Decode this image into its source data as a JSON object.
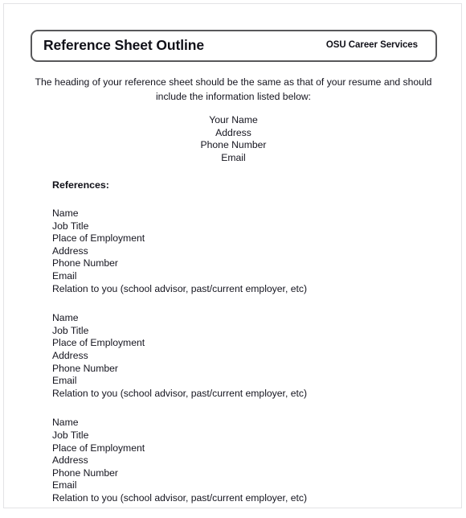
{
  "document": {
    "title": "Reference Sheet Outline",
    "organization": "OSU Career Services",
    "intro": "The heading of your reference sheet should be the same as that of your resume and should include the information listed below:",
    "heading_sample": [
      "Your Name",
      "Address",
      "Phone Number",
      "Email"
    ],
    "references_label": "References:",
    "reference_blocks": [
      {
        "lines": [
          "Name",
          "Job Title",
          "Place of Employment",
          "Address",
          "Phone Number",
          "Email",
          "Relation to you (school advisor, past/current employer, etc)"
        ]
      },
      {
        "lines": [
          "Name",
          "Job Title",
          "Place of Employment",
          "Address",
          "Phone Number",
          "Email",
          "Relation to you (school advisor, past/current employer, etc)"
        ]
      },
      {
        "lines": [
          "Name",
          "Job Title",
          "Place of Employment",
          "Address",
          "Phone Number",
          "Email",
          "Relation to you (school advisor, past/current employer, etc)"
        ]
      }
    ]
  },
  "colors": {
    "text": "#15151f",
    "title_border": "#58585a",
    "page_border": "#e3e3e6",
    "page_background": "#ffffff"
  }
}
